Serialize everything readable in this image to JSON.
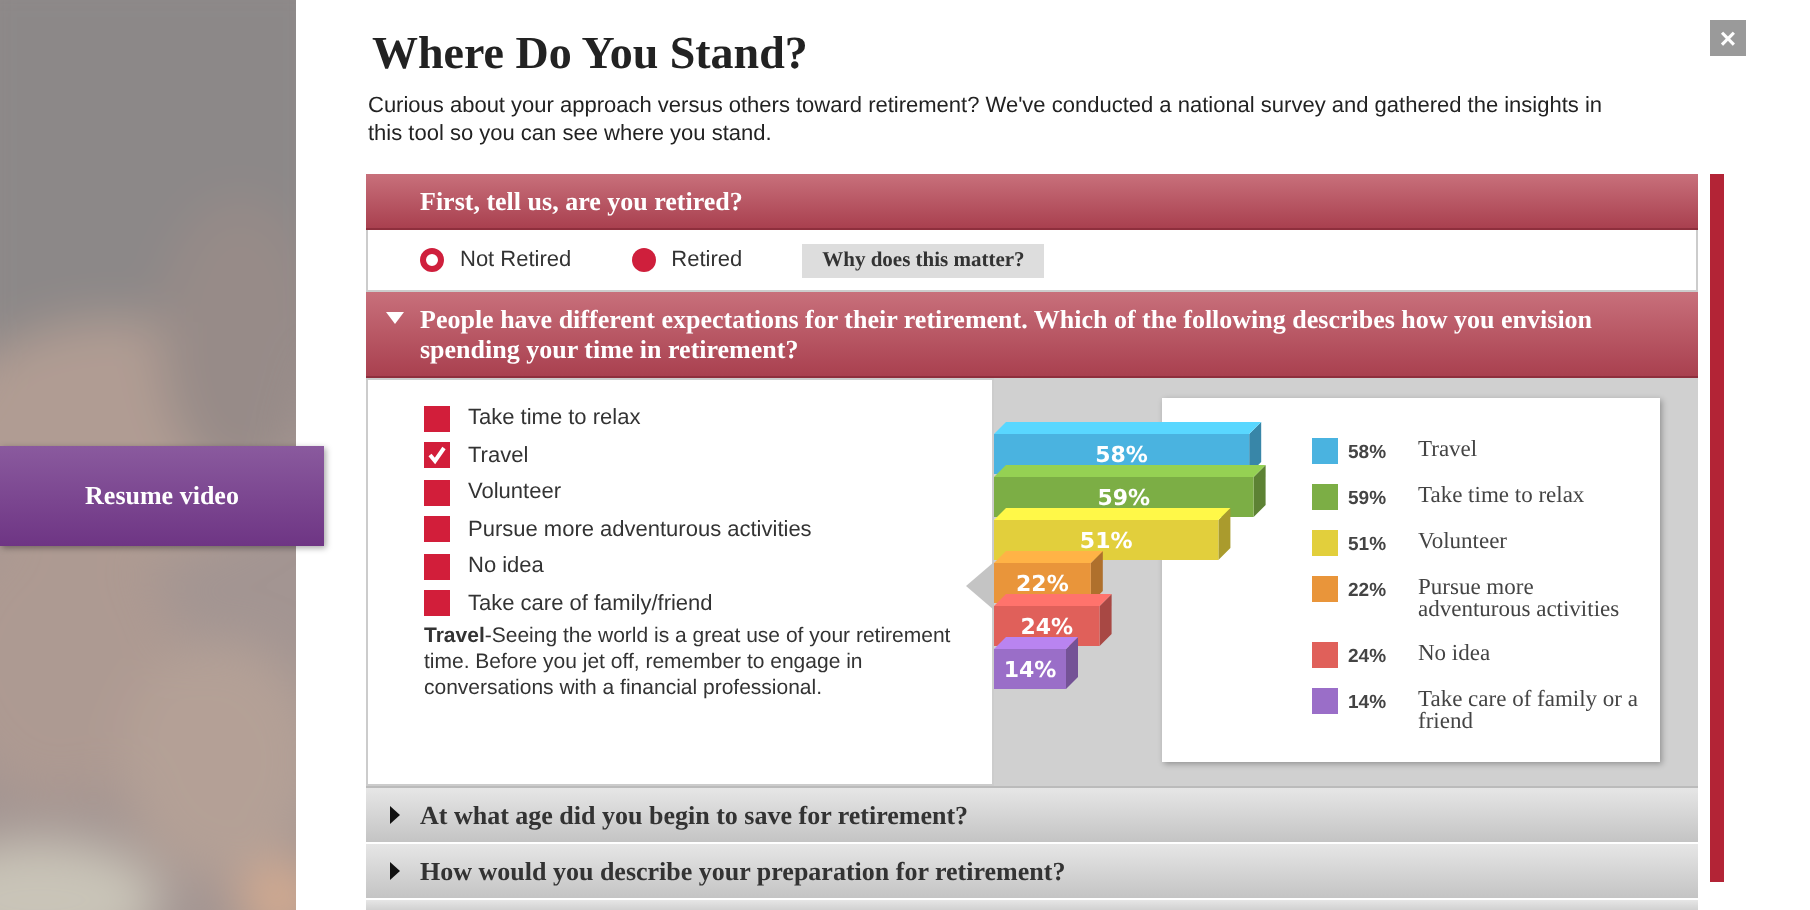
{
  "backdrop": {
    "kind": "picture",
    "resume_button": "Resume video"
  },
  "dialog": {
    "title": "Where Do You Stand?",
    "close": "×",
    "intro": "Curious about your approach versus others toward retirement? We've conducted a national survey and gathered the insights in this tool so you can see where you stand."
  },
  "sections": [
    {
      "kind": "radio",
      "title": "First, tell us, are you retired?",
      "expanded": true,
      "options": [
        {
          "label": "Not Retired",
          "selected": true
        },
        {
          "label": "Retired",
          "selected": false
        }
      ],
      "help_button": "Why does this matter?"
    },
    {
      "kind": "choices",
      "title": "People have different expectations for their retirement. Which of the following describes how you envision spending your time in retirement?",
      "expanded": true,
      "choices": [
        {
          "label": "Take time to relax",
          "checked": false
        },
        {
          "label": "Travel",
          "checked": true
        },
        {
          "label": "Volunteer",
          "checked": false
        },
        {
          "label": "Pursue more adventurous activities",
          "checked": false
        },
        {
          "label": "No idea",
          "checked": false
        },
        {
          "label": "Take care of family/friend",
          "checked": false
        }
      ],
      "note": "**Travel**-Seeing the world is a great use of your retirement time. Before you jet off, remember to engage in conversations with a financial professional.",
      "bars": [
        {
          "label": "58%"
        },
        {
          "label": "59%"
        },
        {
          "label": "51%"
        },
        {
          "label": "22%"
        },
        {
          "label": "24%"
        },
        {
          "label": "14%"
        }
      ],
      "legend": [
        {
          "percent": "58%",
          "label": "Travel",
          "color": "#4ab3e0"
        },
        {
          "percent": "59%",
          "label": "Take time to relax",
          "color": "#7cae45"
        },
        {
          "percent": "51%",
          "label": "Volunteer",
          "color": "#e2cf3c"
        },
        {
          "percent": "22%",
          "label": "Pursue more adventurous activities",
          "color": "#e9953a"
        },
        {
          "percent": "24%",
          "label": "No idea",
          "color": "#e0605a"
        },
        {
          "percent": "14%",
          "label": "Take care of family or a friend",
          "color": "#9a6ec8"
        }
      ]
    },
    {
      "kind": "collapsed",
      "title": "At what age did you begin to save for retirement?",
      "expanded": false
    },
    {
      "kind": "collapsed",
      "title": "How would you describe your preparation for retirement?",
      "expanded": false
    },
    {
      "kind": "collapsed",
      "expanded": false
    }
  ]
}
